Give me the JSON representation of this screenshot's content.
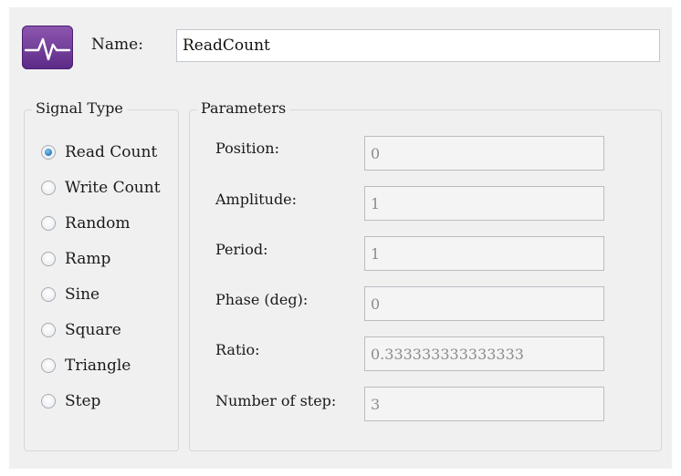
{
  "header": {
    "icon": "signal-waveform-icon",
    "name_label": "Name:",
    "name_value": "ReadCount"
  },
  "signal_type": {
    "title": "Signal Type",
    "options": [
      {
        "label": "Read Count",
        "checked": true
      },
      {
        "label": "Write Count",
        "checked": false
      },
      {
        "label": "Random",
        "checked": false
      },
      {
        "label": "Ramp",
        "checked": false
      },
      {
        "label": "Sine",
        "checked": false
      },
      {
        "label": "Square",
        "checked": false
      },
      {
        "label": "Triangle",
        "checked": false
      },
      {
        "label": "Step",
        "checked": false
      }
    ]
  },
  "parameters": {
    "title": "Parameters",
    "fields": [
      {
        "label": "Position:",
        "value": "0"
      },
      {
        "label": "Amplitude:",
        "value": "1"
      },
      {
        "label": "Period:",
        "value": "1"
      },
      {
        "label": "Phase (deg):",
        "value": "0"
      },
      {
        "label": "Ratio:",
        "value": "0.333333333333333"
      },
      {
        "label": "Number of step:",
        "value": "3"
      }
    ]
  },
  "colors": {
    "icon_gradient_top": "#8e57b0",
    "icon_gradient_bottom": "#5b2a86",
    "radio_selected": "#1f6fb0",
    "disabled_text": "#8c8c8c"
  }
}
